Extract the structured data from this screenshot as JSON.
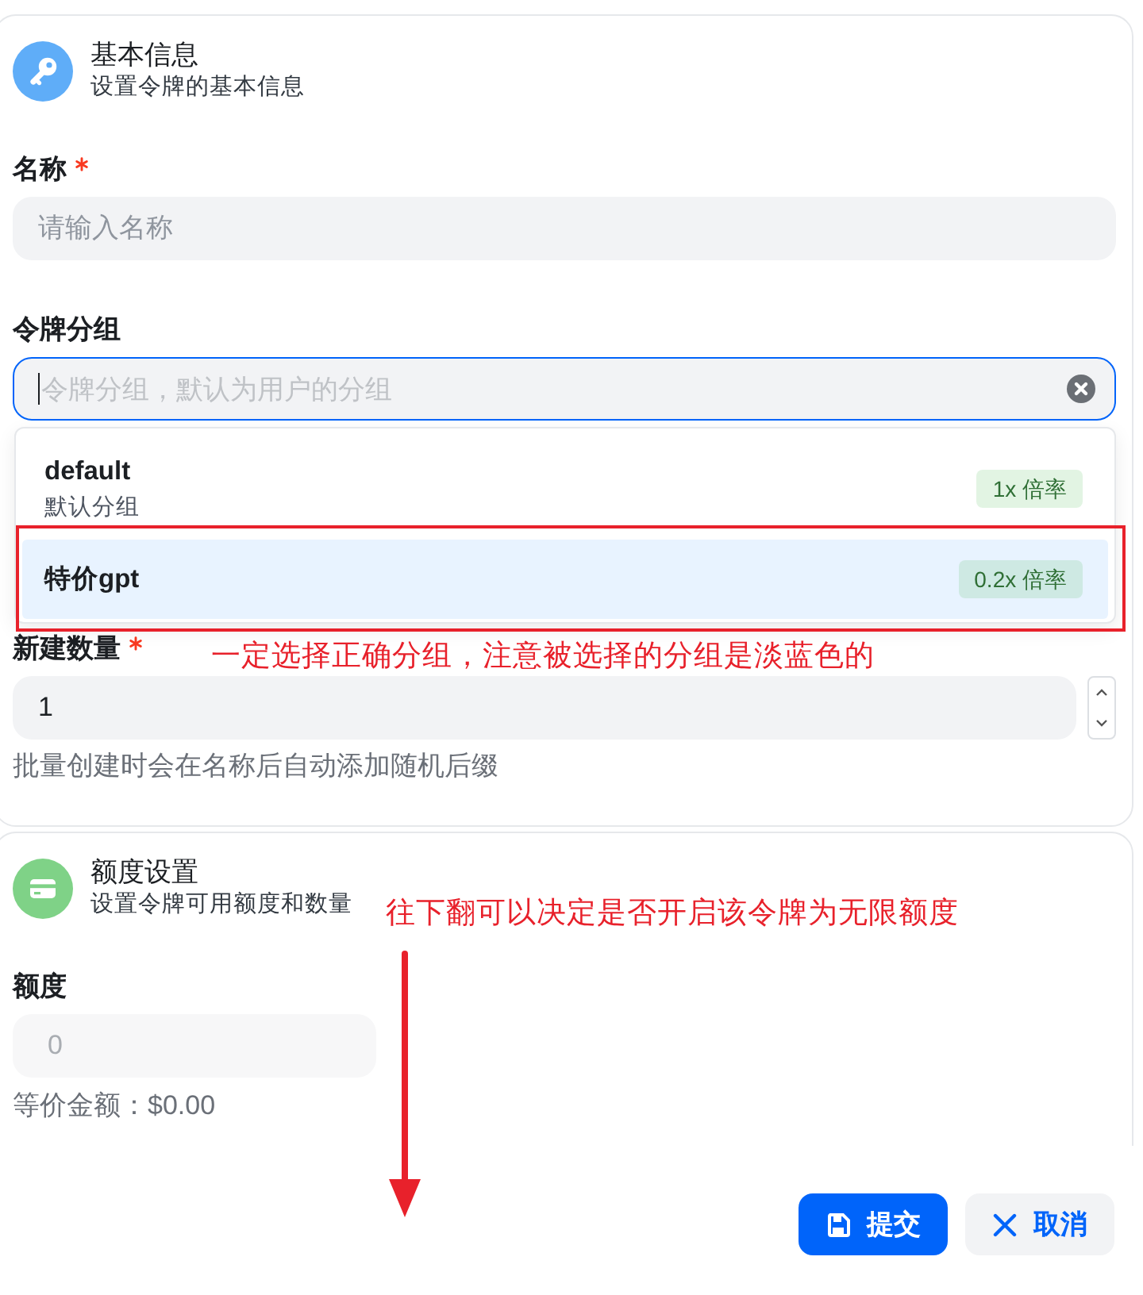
{
  "basic_info": {
    "title": "基本信息",
    "subtitle": "设置令牌的基本信息",
    "name_field": {
      "label": "名称",
      "required": true,
      "placeholder": "请输入名称"
    },
    "group_field": {
      "label": "令牌分组",
      "placeholder": "令牌分组，默认为用户的分组",
      "focused": true,
      "options": [
        {
          "name": "default",
          "description": "默认分组",
          "ratio": "1x 倍率",
          "selected": false
        },
        {
          "name": "特价gpt",
          "ratio": "0.2x 倍率",
          "selected": true
        }
      ]
    },
    "count_field": {
      "label": "新建数量",
      "required": true,
      "value": "1",
      "help": "批量创建时会在名称后自动添加随机后缀"
    }
  },
  "quota_settings": {
    "title": "额度设置",
    "subtitle": "设置令牌可用额度和数量",
    "quota_field": {
      "label": "额度",
      "value": "0",
      "disabled": true,
      "equivalent": "等价金额：$0.00"
    }
  },
  "buttons": [
    {
      "kind": "submit",
      "label": "提交"
    },
    {
      "kind": "cancel",
      "label": "取消"
    }
  ],
  "annotations": {
    "group_note": "一定选择正确分组，注意被选择的分组是淡蓝色的",
    "quota_note": "往下翻可以决定是否开启该令牌为无限额度"
  }
}
